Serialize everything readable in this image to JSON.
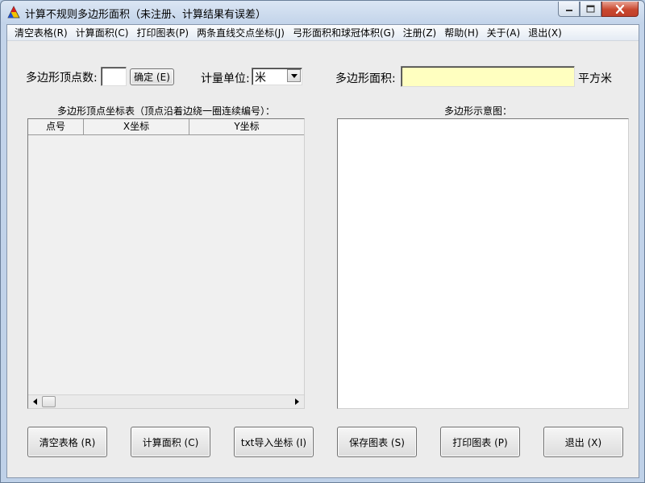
{
  "window": {
    "title": "计算不规则多边形面积（未注册、计算结果有误差）"
  },
  "menu": [
    {
      "label": "清空表格(R)"
    },
    {
      "label": "计算面积(C)"
    },
    {
      "label": "打印图表(P)"
    },
    {
      "label": "两条直线交点坐标(J)"
    },
    {
      "label": "弓形面积和球冠体积(G)"
    },
    {
      "label": "注册(Z)"
    },
    {
      "label": "帮助(H)"
    },
    {
      "label": "关于(A)"
    },
    {
      "label": "退出(X)"
    }
  ],
  "form": {
    "vertex_count_label": "多边形顶点数:",
    "vertex_count_value": "",
    "confirm_button": "确定 (E)",
    "unit_label": "计量单位:",
    "unit_value": "米",
    "area_label": "多边形面积:",
    "area_value": "",
    "area_unit": "平方米"
  },
  "table": {
    "caption": "多边形顶点坐标表（顶点沿着边绕一圈连续编号）：",
    "columns": [
      "点号",
      "X坐标",
      "Y坐标"
    ],
    "rows": []
  },
  "diagram": {
    "caption": "多边形示意图："
  },
  "buttons": {
    "clear": "清空表格 (R)",
    "calculate": "计算面积 (C)",
    "import": "txt导入坐标 (I)",
    "save": "保存图表 (S)",
    "print": "打印图表 (P)",
    "exit": "退出 (X)"
  },
  "colors": {
    "area_field_bg": "#ffffc0",
    "close_button": "#c9482f"
  },
  "icons": {
    "app": "triangle-app-icon",
    "minimize": "minimize-icon",
    "maximize": "maximize-icon",
    "close": "close-icon",
    "dropdown": "chevron-down-icon",
    "scroll_left": "arrow-left-icon",
    "scroll_right": "arrow-right-icon"
  }
}
